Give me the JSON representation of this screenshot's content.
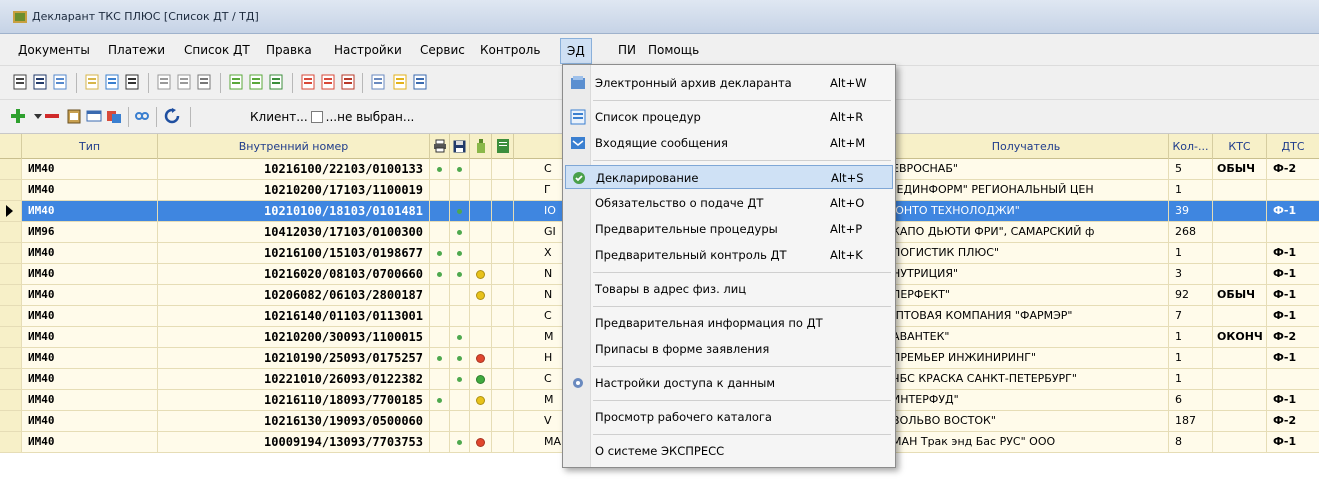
{
  "window": {
    "title": "Декларант ТКС ПЛЮС [Список ДТ / ТД]"
  },
  "menu": [
    "Документы",
    "Платежи",
    "Список ДТ",
    "Правка",
    "Настройки",
    "Сервис",
    "Контроль",
    "ЭД",
    "ПИ",
    "Помощь"
  ],
  "open_menu": "ЭД",
  "toolbar2": {
    "client_label": "Клиент...",
    "client_value": "...не выбран..."
  },
  "columns": {
    "type": "Тип",
    "internal_number": "Внутренний номер",
    "recipient": "Получатель",
    "count": "Кол-...",
    "kts": "КТС",
    "dts": "ДТС"
  },
  "rows": [
    {
      "type": "ИМ40",
      "number": "10216100/22103/0100133",
      "m1": true,
      "m2": true,
      "light": "",
      "sender": "C",
      "recipient": "\"ЕВРОСНАБ\"",
      "count": "5",
      "kts": "ОБЫЧ",
      "dts": "Ф-2",
      "selected": false
    },
    {
      "type": "ИМ40",
      "number": "10210200/17103/1100019",
      "m1": false,
      "m2": false,
      "light": "",
      "sender": "Г",
      "recipient": "МЕДИНФОРМ\" РЕГИОНАЛЬНЫЙ ЦЕН",
      "count": "1",
      "kts": "",
      "dts": "",
      "selected": false
    },
    {
      "type": "ИМ40",
      "number": "10210100/18103/0101481",
      "m1": false,
      "m2": true,
      "light": "",
      "sender": "IO",
      "recipient": "ИОНТО ТЕХНОЛОДЖИ\"",
      "count": "39",
      "kts": "",
      "dts": "Ф-1",
      "selected": true
    },
    {
      "type": "ИМ96",
      "number": "10412030/17103/0100300",
      "m1": false,
      "m2": true,
      "light": "",
      "sender": "GI",
      "recipient": "\"КАПО ДЬЮТИ ФРИ\", САМАРСКИЙ ф",
      "count": "268",
      "kts": "",
      "dts": "",
      "selected": false
    },
    {
      "type": "ИМ40",
      "number": "10216100/15103/0198677",
      "m1": true,
      "m2": true,
      "light": "",
      "sender": "X",
      "recipient": "\"ЛОГИСТИК ПЛЮС\"",
      "count": "1",
      "kts": "",
      "dts": "Ф-1",
      "selected": false
    },
    {
      "type": "ИМ40",
      "number": "10216020/08103/0700660",
      "m1": true,
      "m2": true,
      "light": "#e8c21a",
      "sender": "N",
      "recipient": "\"НУТРИЦИЯ\"",
      "count": "3",
      "kts": "",
      "dts": "Ф-1",
      "selected": false
    },
    {
      "type": "ИМ40",
      "number": "10206082/06103/2800187",
      "m1": false,
      "m2": false,
      "light": "#e8c21a",
      "sender": "N",
      "recipient": "\"ПЕРФЕКТ\"",
      "count": "92",
      "kts": "ОБЫЧ",
      "dts": "Ф-1",
      "selected": false
    },
    {
      "type": "ИМ40",
      "number": "10216140/01103/0113001",
      "m1": false,
      "m2": false,
      "light": "",
      "sender": "C",
      "recipient": "ОПТОВАЯ КОМПАНИЯ \"ФАРМЭР\"",
      "count": "7",
      "kts": "",
      "dts": "Ф-1",
      "selected": false
    },
    {
      "type": "ИМ40",
      "number": "10210200/30093/1100015",
      "m1": false,
      "m2": true,
      "light": "",
      "sender": "M",
      "recipient": "\"АВАНТЕК\"",
      "count": "1",
      "kts": "ОКОНЧ",
      "dts": "Ф-2",
      "selected": false
    },
    {
      "type": "ИМ40",
      "number": "10210190/25093/0175257",
      "m1": true,
      "m2": true,
      "light": "#e0462e",
      "sender": "H",
      "recipient": "\"ПРЕМЬЕР ИНЖИНИРИНГ\"",
      "count": "1",
      "kts": "",
      "dts": "Ф-1",
      "selected": false
    },
    {
      "type": "ИМ40",
      "number": "10221010/26093/0122382",
      "m1": false,
      "m2": true,
      "light": "#3faa3f",
      "sender": "C",
      "recipient": "\"ЧБС КРАСКА САНКТ-ПЕТЕРБУРГ\"",
      "count": "1",
      "kts": "",
      "dts": "",
      "selected": false
    },
    {
      "type": "ИМ40",
      "number": "10216110/18093/7700185",
      "m1": true,
      "m2": false,
      "light": "#e8c21a",
      "sender": "M",
      "recipient": "\"ИНТЕРФУД\"",
      "count": "6",
      "kts": "",
      "dts": "Ф-1",
      "selected": false
    },
    {
      "type": "ИМ40",
      "number": "10216130/19093/0500060",
      "m1": false,
      "m2": false,
      "light": "",
      "sender": "V",
      "recipient": "\"ВОЛЬВО ВОСТОК\"",
      "count": "187",
      "kts": "",
      "dts": "Ф-2",
      "selected": false
    },
    {
      "type": "ИМ40",
      "number": "10009194/13093/7703753",
      "m1": false,
      "m2": true,
      "light": "#e0462e",
      "sender": "MAN TRUCK & BUS AG",
      "recipient": "\"МАН Трак энд Бас РУС\" ООО",
      "count": "8",
      "kts": "",
      "dts": "Ф-1",
      "selected": false
    }
  ],
  "dropdown": [
    {
      "label": "Электронный архив декларанта",
      "key": "Alt+W",
      "icon": "archive-icon"
    },
    {
      "sep": true
    },
    {
      "label": "Список процедур",
      "key": "Alt+R",
      "icon": "list-icon"
    },
    {
      "label": "Входящие сообщения",
      "key": "Alt+M",
      "icon": "inbox-icon"
    },
    {
      "sep": true
    },
    {
      "label": "Декларирование",
      "key": "Alt+S",
      "icon": "declare-icon",
      "highlight": true
    },
    {
      "label": "Обязательство о подаче ДТ",
      "key": "Alt+O"
    },
    {
      "label": "Предварительные процедуры",
      "key": "Alt+P"
    },
    {
      "label": "Предварительный контроль ДТ",
      "key": "Alt+K"
    },
    {
      "sep": true
    },
    {
      "label": "Товары в адрес физ. лиц"
    },
    {
      "sep": true
    },
    {
      "label": "Предварительная информация по ДТ"
    },
    {
      "label": "Припасы в форме заявления"
    },
    {
      "sep": true
    },
    {
      "label": "Настройки доступа к данным",
      "icon": "settings-icon"
    },
    {
      "sep": true
    },
    {
      "label": "Просмотр рабочего каталога"
    },
    {
      "sep": true
    },
    {
      "label": "О системе ЭКСПРЕСС"
    }
  ]
}
